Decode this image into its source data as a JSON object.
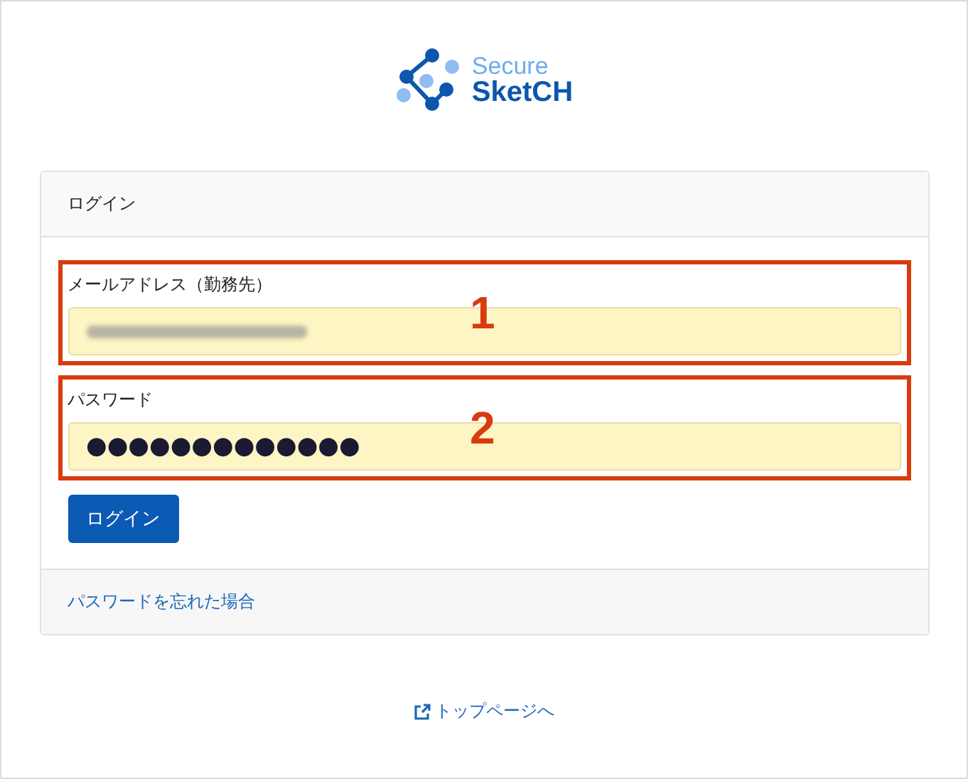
{
  "logo": {
    "line_1": "Secure",
    "line_2": "SketCH"
  },
  "card": {
    "header": "ログイン",
    "fields": [
      {
        "label": "メールアドレス（勤務先）",
        "kind": "blurred",
        "callout": "1"
      },
      {
        "label": "パスワード",
        "value": "●●●●●●●●●●●●●",
        "kind": "masked",
        "callout": "2"
      }
    ],
    "submit": "ログイン",
    "footer_link": "パスワードを忘れた場合"
  },
  "top_link": "トップページへ"
}
